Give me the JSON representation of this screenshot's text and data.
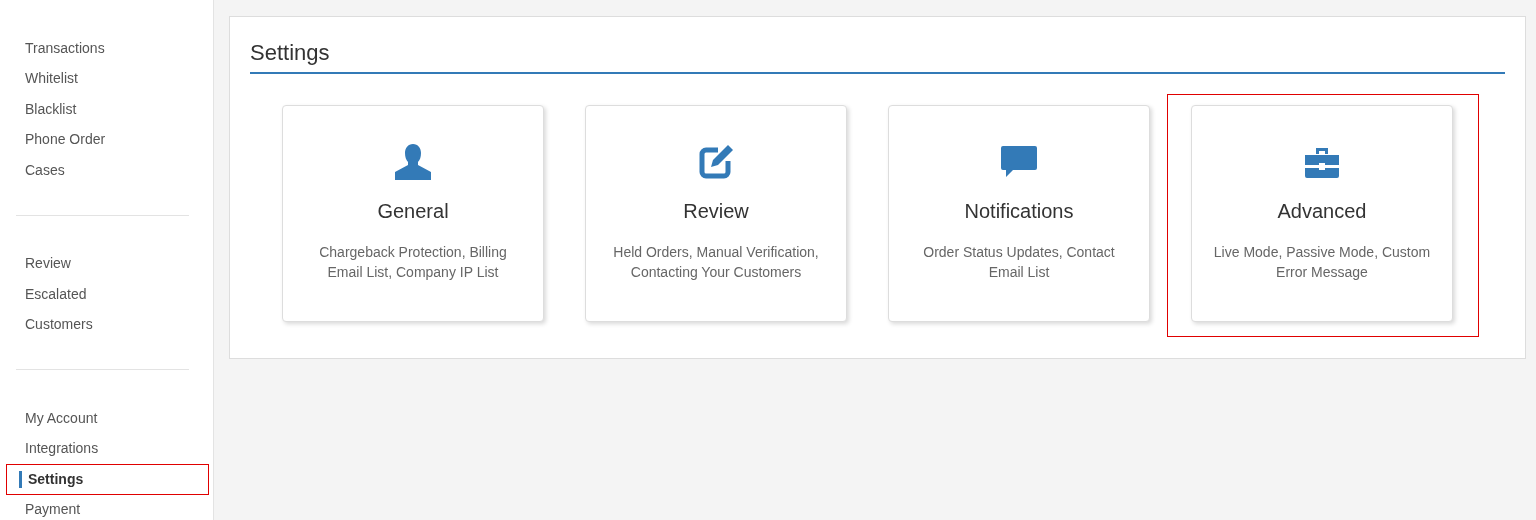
{
  "sidebar": {
    "groups": [
      {
        "items": [
          {
            "label": "Transactions",
            "selected": false,
            "highlighted": false
          },
          {
            "label": "Whitelist",
            "selected": false,
            "highlighted": false
          },
          {
            "label": "Blacklist",
            "selected": false,
            "highlighted": false
          },
          {
            "label": "Phone Order",
            "selected": false,
            "highlighted": false
          },
          {
            "label": "Cases",
            "selected": false,
            "highlighted": false
          }
        ]
      },
      {
        "items": [
          {
            "label": "Review",
            "selected": false,
            "highlighted": false
          },
          {
            "label": "Escalated",
            "selected": false,
            "highlighted": false
          },
          {
            "label": "Customers",
            "selected": false,
            "highlighted": false
          }
        ]
      },
      {
        "items": [
          {
            "label": "My Account",
            "selected": false,
            "highlighted": false
          },
          {
            "label": "Integrations",
            "selected": false,
            "highlighted": false
          },
          {
            "label": "Settings",
            "selected": true,
            "highlighted": true
          },
          {
            "label": "Payment",
            "selected": false,
            "highlighted": false
          }
        ]
      }
    ]
  },
  "panel": {
    "title": "Settings",
    "cards": [
      {
        "kind": "person",
        "title": "General",
        "description": "Chargeback Protection, Billing Email List, Company IP List",
        "highlighted": false
      },
      {
        "kind": "edit",
        "title": "Review",
        "description": "Held Orders, Manual Verification, Contacting Your Customers",
        "highlighted": false
      },
      {
        "kind": "chat",
        "title": "Notifications",
        "description": "Order Status Updates, Contact Email List",
        "highlighted": false
      },
      {
        "kind": "briefcase",
        "title": "Advanced",
        "description": "Live Mode, Passive Mode, Custom Error Message",
        "highlighted": true
      }
    ]
  }
}
